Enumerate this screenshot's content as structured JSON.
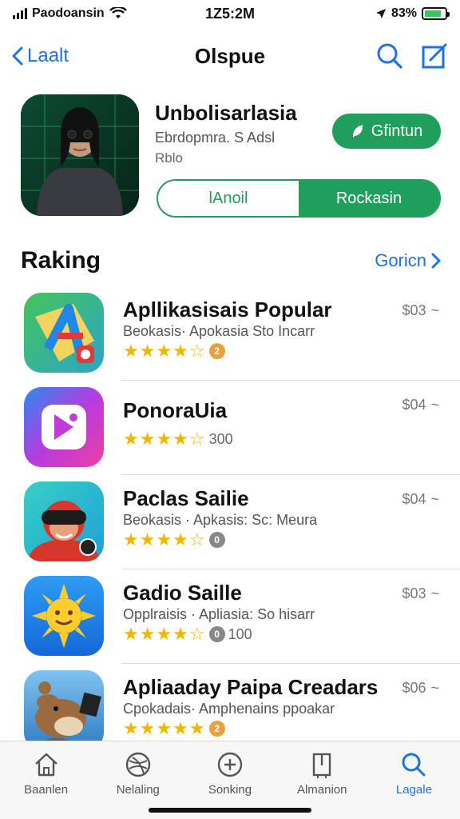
{
  "status_bar": {
    "carrier": "Paodoansin",
    "time": "1Z5:2M",
    "battery": "83%",
    "battery_level": 0.83
  },
  "nav": {
    "back_label": "Laalt",
    "title": "Olspue",
    "search_icon": "search-icon",
    "compose_icon": "compose-icon"
  },
  "featured": {
    "title": "Unbolisarlasia",
    "subtitle": "Ebrdopmra. S Adsl",
    "subtitle2": "Rblo",
    "get_label": "Gfintun",
    "segment_left": "lAnoil",
    "segment_right": "Rockasin"
  },
  "section": {
    "title": "Raking",
    "see_all": "Goricn"
  },
  "apps": [
    {
      "name": "Apllikasisais Popular",
      "subtitle": "Beokasis· Apokasia Sto Incarr",
      "stars": "★★★★☆",
      "badge": "2",
      "rating_count": "",
      "price": "$03"
    },
    {
      "name": "PonoraUia",
      "subtitle": "",
      "stars": "★★★★☆",
      "badge": "",
      "rating_count": "300",
      "price": "$04"
    },
    {
      "name": "Paclas Sailie",
      "subtitle": "Beokasis · Apkasis: Sc: Meura",
      "stars": "★★★★☆",
      "badge": "0",
      "rating_count": "",
      "price": "$04"
    },
    {
      "name": "Gadio Saille",
      "subtitle": "Opplraisis · Apliasia: So hisarr",
      "stars": "★★★★☆",
      "badge": "0",
      "rating_count": "100",
      "price": "$03"
    },
    {
      "name": "Apliaaday Paipa Creadars",
      "subtitle": "Cpokadais· Amphenains ppoakar",
      "stars": "★★★★★",
      "badge": "2",
      "rating_count": "",
      "price": "$06"
    }
  ],
  "tabs": [
    {
      "label": "Baanlen",
      "icon": "home-icon"
    },
    {
      "label": "Nelaling",
      "icon": "globe-icon"
    },
    {
      "label": "Sonking",
      "icon": "plus-circle-icon"
    },
    {
      "label": "Almanion",
      "icon": "bookmark-icon"
    },
    {
      "label": "Lagale",
      "icon": "search-icon"
    }
  ],
  "colors": {
    "accent_blue": "#1a73e8",
    "accent_green": "#1f9f5b",
    "star": "#f4b400"
  }
}
